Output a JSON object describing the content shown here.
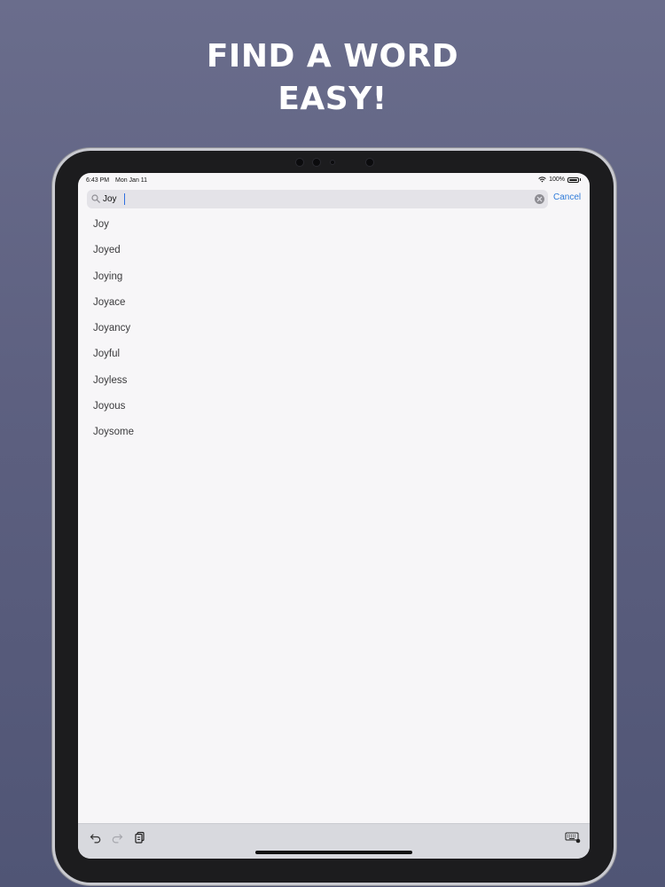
{
  "headline": {
    "line1": "FIND A WORD",
    "line2": "EASY!"
  },
  "status_bar": {
    "time": "6:43 PM",
    "date": "Mon Jan 11",
    "battery": "100%"
  },
  "search": {
    "value": "Joy",
    "cancel_label": "Cancel"
  },
  "results": [
    "Joy",
    "Joyed",
    "Joying",
    "Joyace",
    "Joyancy",
    "Joyful",
    "Joyless",
    "Joyous",
    "Joysome"
  ],
  "toolbar": {
    "icons": [
      "undo-icon",
      "redo-icon",
      "paste-icon",
      "keyboard-icon"
    ]
  },
  "colors": {
    "background": "#5d6080",
    "accent": "#2f7bd9",
    "screen": "#f7f6f8"
  }
}
